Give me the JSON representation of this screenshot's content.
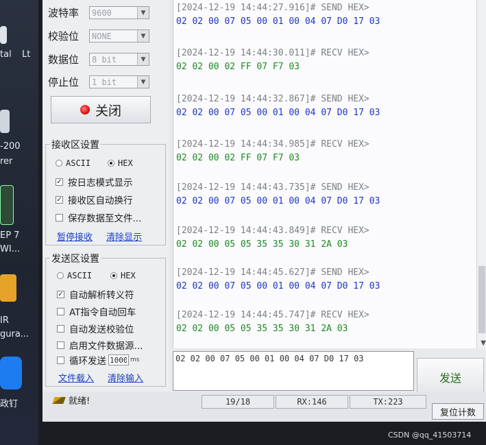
{
  "desktop": {
    "labels": [
      "tal",
      "Lt",
      "-200",
      "rer",
      "EP 7",
      "WI...",
      "IR",
      "gura...",
      "政钉"
    ]
  },
  "serial_settings": {
    "baud": {
      "label": "波特率",
      "value": "9600"
    },
    "parity": {
      "label": "校验位",
      "value": "NONE"
    },
    "data_bits": {
      "label": "数据位",
      "value": "8 bit"
    },
    "stop_bits": {
      "label": "停止位",
      "value": "1 bit"
    },
    "close_button": "关闭"
  },
  "receive_settings": {
    "title": "接收区设置",
    "ascii_label": "ASCII",
    "hex_label": "HEX",
    "log_mode": "按日志模式显示",
    "auto_newline": "接收区自动换行",
    "save_to_file": "保存数据至文件...",
    "pause_receive": "暂停接收",
    "clear_display": "清除显示"
  },
  "send_settings": {
    "title": "发送区设置",
    "ascii_label": "ASCII",
    "hex_label": "HEX",
    "parse_escape": "自动解析转义符",
    "at_auto_newline": "AT指令自动回车",
    "auto_checksum": "自动发送校验位",
    "file_source": "启用文件数据源...",
    "loop_send": "循环发送",
    "loop_interval": "1000",
    "loop_unit": "ms",
    "file_load": "文件载入",
    "clear_input": "清除输入"
  },
  "log": [
    {
      "time": "[2024-12-19 14:44:27.916]# SEND HEX>",
      "dir": "send",
      "hex": "02 02 00 07 05 00 01 00 04 07 D0 17 03"
    },
    {
      "time": "[2024-12-19 14:44:30.011]# RECV HEX>",
      "dir": "recv",
      "hex": "02 02 00 02 FF 07 F7 03"
    },
    {
      "time": "[2024-12-19 14:44:32.867]# SEND HEX>",
      "dir": "send",
      "hex": "02 02 00 07 05 00 01 00 04 07 D0 17 03"
    },
    {
      "time": "[2024-12-19 14:44:34.985]# RECV HEX>",
      "dir": "recv",
      "hex": "02 02 00 02 FF 07 F7 03"
    },
    {
      "time": "[2024-12-19 14:44:43.735]# SEND HEX>",
      "dir": "send",
      "hex": "02 02 00 07 05 00 01 00 04 07 D0 17 03"
    },
    {
      "time": "[2024-12-19 14:44:43.849]# RECV HEX>",
      "dir": "recv",
      "hex": "02 02 00 05 05 35 35 30 31 2A 03"
    },
    {
      "time": "[2024-12-19 14:44:45.627]# SEND HEX>",
      "dir": "send",
      "hex": "02 02 00 07 05 00 01 00 04 07 D0 17 03"
    },
    {
      "time": "[2024-12-19 14:44:45.747]# RECV HEX>",
      "dir": "recv",
      "hex": "02 02 00 05 05 35 35 30 31 2A 03"
    }
  ],
  "send_input": "02 02 00 07 05 00 01 00 04 07 D0 17 03",
  "send_button": "发送",
  "status": {
    "ready": "就绪!",
    "count": "19/18",
    "rx": "RX:146",
    "tx": "TX:223",
    "reset": "复位计数"
  },
  "watermark": "CSDN @qq_41503714"
}
